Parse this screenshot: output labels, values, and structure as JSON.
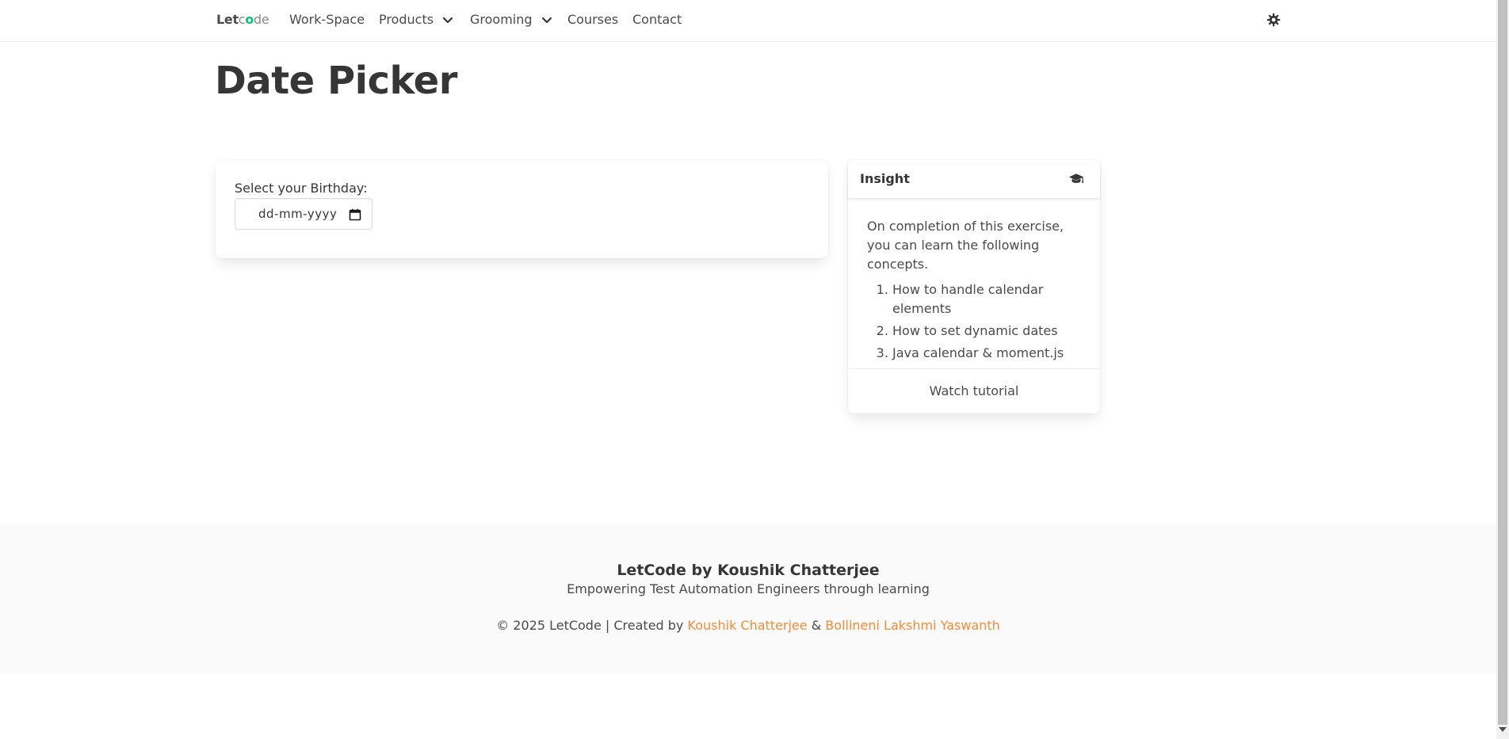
{
  "navbar": {
    "brand": {
      "part1": "Let",
      "part2": "c",
      "dot": "o",
      "part3": "de"
    },
    "items": [
      {
        "label": "Work-Space"
      },
      {
        "label": "Products"
      },
      {
        "label": "Grooming"
      },
      {
        "label": "Courses"
      },
      {
        "label": "Contact"
      }
    ],
    "theme_icon": "gear-icon"
  },
  "page": {
    "title": "Date Picker"
  },
  "date_card": {
    "label": "Select your Birthday:",
    "placeholder": "dd-mm-yyyy",
    "value": "",
    "icon": "calendar-icon"
  },
  "insight": {
    "title": "Insight",
    "icon": "graduation-cap-icon",
    "intro": "On completion of this exercise, you can learn the following concepts.",
    "items": [
      "How to handle calendar elements",
      "How to set dynamic dates",
      "Java calendar & moment.js"
    ],
    "footer_link": "Watch tutorial"
  },
  "footer": {
    "title": "LetCode by Koushik Chatterjee",
    "subtitle": "Empowering Test Automation Engineers through learning",
    "copyright_prefix": "© 2025 LetCode | Created by",
    "author1": "Koushik Chatterjee",
    "separator": "&",
    "author2": "Bollineni Lakshmi Yaswanth"
  },
  "colors": {
    "brand_dot": "#00c47a",
    "link_accent": "#f28c3b",
    "footer_bg": "#fafafa"
  }
}
